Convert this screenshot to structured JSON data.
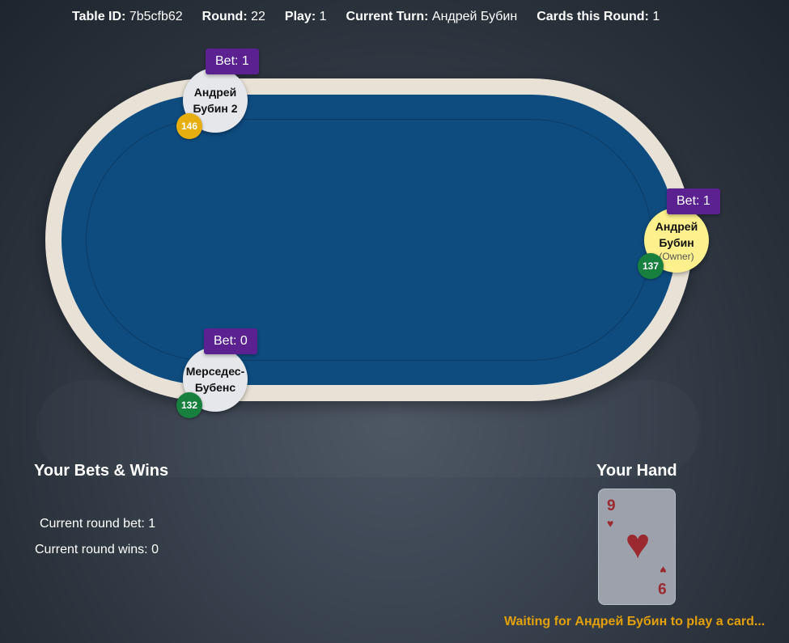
{
  "header": {
    "table_id_label": "Table ID:",
    "table_id_value": "7b5cfb62",
    "round_label": "Round:",
    "round_value": "22",
    "play_label": "Play:",
    "play_value": "1",
    "turn_label": "Current Turn:",
    "turn_value": "Андрей Бубин",
    "cards_label": "Cards this Round:",
    "cards_value": "1"
  },
  "players": [
    {
      "name": "Андрей Бубин 2",
      "bet": "Bet: 1",
      "score": "146",
      "score_color": "#e6ae0e",
      "is_owner": false
    },
    {
      "name": "Андрей Бубин",
      "tag": "(Owner)",
      "bet": "Bet: 1",
      "score": "137",
      "score_color": "#17803f",
      "is_owner": true,
      "seat_color": "#fdf08d"
    },
    {
      "name": "Мерседес-Бубенс",
      "bet": "Bet: 0",
      "score": "132",
      "score_color": "#17803f",
      "is_owner": false
    }
  ],
  "bets_panel": {
    "title": "Your Bets & Wins",
    "current_bet": "Current round bet: 1",
    "current_wins": "Current round wins: 0"
  },
  "hand_panel": {
    "title": "Your Hand",
    "cards": [
      {
        "rank": "9",
        "suit": "♥",
        "suit_icon": "heart-icon",
        "bottom_rank": "6"
      }
    ]
  },
  "status": {
    "message": "Waiting for Андрей Бубин to play a card...",
    "color": "#e3a008"
  },
  "colors": {
    "felt": "#0e4c80",
    "rail": "#e8e2d6",
    "bet_badge": "#5b2191",
    "card_red": "#9b2a30"
  }
}
